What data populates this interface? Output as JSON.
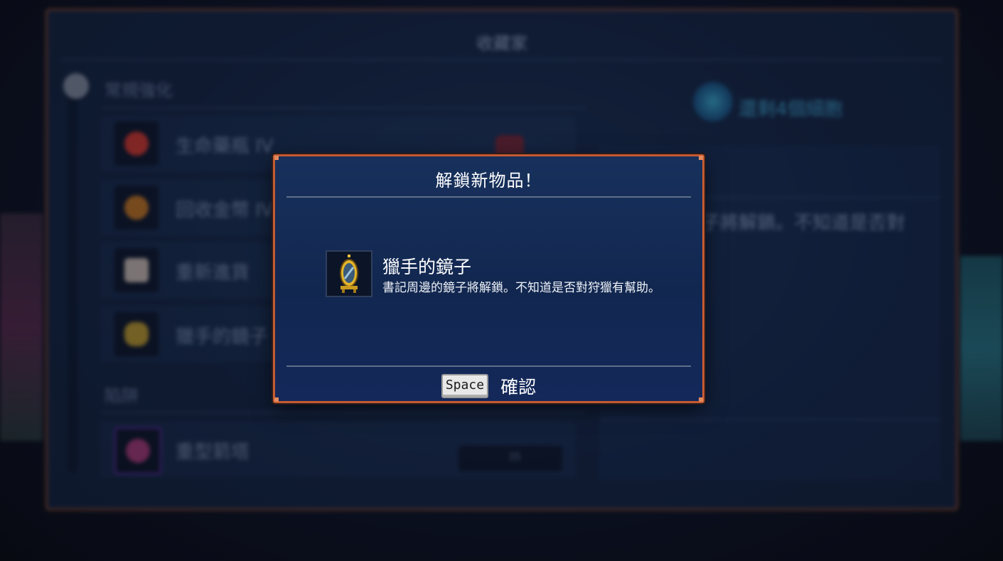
{
  "background": {
    "window_title": "收藏家",
    "section_regular": "常規強化",
    "section_traps": "陷阱",
    "items": [
      {
        "label": "生命藥瓶 IV",
        "icon": "health-flask-icon",
        "color": "#e0382a"
      },
      {
        "label": "回收金幣 IV",
        "icon": "gold-coins-icon",
        "color": "#d07a1c"
      },
      {
        "label": "重新進貨",
        "icon": "dice-icon",
        "color": "#d8c6b8"
      },
      {
        "label": "獵手的鏡子",
        "icon": "mirror-icon",
        "color": "#c9a22a"
      },
      {
        "label": "重型箭塔",
        "icon": "heavy-turret-icon",
        "color": "#b03a7a"
      }
    ],
    "trap_counter": "35",
    "cells_remaining": "還剩4個細胞",
    "description_fragment": "子將解鎖。不知道是否對"
  },
  "modal": {
    "title": "解鎖新物品！",
    "item_name": "獵手的鏡子",
    "item_description": "書記周邊的鏡子將解鎖。不知道是否對狩獵有幫助。",
    "item_icon": "mirror-icon",
    "key_label": "Space",
    "confirm_label": "確認"
  },
  "colors": {
    "modal_border": "#c55a32",
    "modal_bg": "#14285a",
    "mirror_gold": "#d4a82a"
  }
}
